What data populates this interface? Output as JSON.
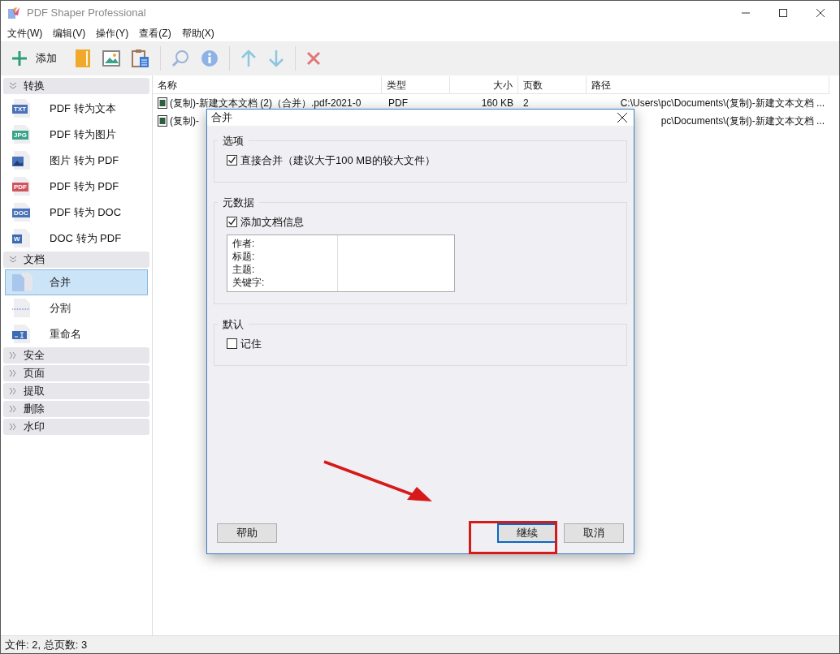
{
  "window": {
    "title": "PDF Shaper Professional"
  },
  "menu": [
    "文件(W)",
    "编辑(V)",
    "操作(Y)",
    "查看(Z)",
    "帮助(X)"
  ],
  "toolbar": [
    {
      "kind": "add",
      "label": "添加"
    },
    {
      "kind": "folder"
    },
    {
      "kind": "image"
    },
    {
      "kind": "paste"
    },
    {
      "kind": "separator"
    },
    {
      "kind": "search"
    },
    {
      "kind": "info"
    },
    {
      "kind": "separator"
    },
    {
      "kind": "up"
    },
    {
      "kind": "down"
    },
    {
      "kind": "separator"
    },
    {
      "kind": "delete"
    }
  ],
  "sidebar": {
    "groups": [
      {
        "label": "转换",
        "expanded": true,
        "items": [
          {
            "label": "PDF 转为文本",
            "kind": "badge",
            "icon_text": "TXT",
            "color": "#4a72b8",
            "selected": false
          },
          {
            "label": "PDF 转为图片",
            "kind": "badge",
            "icon_text": "JPG",
            "color": "#3aa48a",
            "selected": false
          },
          {
            "label": "图片 转为 PDF",
            "kind": "image",
            "selected": false
          },
          {
            "label": "PDF 转为 PDF",
            "kind": "badge",
            "icon_text": "PDF",
            "color": "#d0545e",
            "selected": false
          },
          {
            "label": "PDF 转为 DOC",
            "kind": "badge",
            "icon_text": "DOC",
            "color": "#4a72b8",
            "selected": false
          },
          {
            "label": "DOC 转为 PDF",
            "kind": "badge",
            "icon_text": "W",
            "color": "#3c6cb4",
            "selected": false
          }
        ]
      },
      {
        "label": "文档",
        "expanded": true,
        "items": [
          {
            "label": "合并",
            "kind": "merge",
            "selected": true
          },
          {
            "label": "分割",
            "kind": "split",
            "selected": false
          },
          {
            "label": "重命名",
            "kind": "rename",
            "selected": false
          }
        ]
      },
      {
        "label": "安全",
        "expanded": false
      },
      {
        "label": "页面",
        "expanded": false
      },
      {
        "label": "提取",
        "expanded": false
      },
      {
        "label": "删除",
        "expanded": false
      },
      {
        "label": "水印",
        "expanded": false
      }
    ]
  },
  "table": {
    "columns": [
      "名称",
      "类型",
      "大小",
      "页数",
      "路径"
    ],
    "rows": [
      {
        "name": "(复制)-新建文本文档 (2)（合并）.pdf-2021-0",
        "type": "PDF",
        "size": "160 KB",
        "pages": "2",
        "path": "C:\\Users\\pc\\Documents\\(复制)-新建文本文档 ..."
      },
      {
        "name": "(复制)-",
        "path": "pc\\Documents\\(复制)-新建文本文档 ..."
      }
    ]
  },
  "dialog": {
    "title": "合并",
    "sections": [
      {
        "title": "选项",
        "checkbox": {
          "label": "直接合并（建议大于100 MB的较大文件）",
          "checked": true
        }
      },
      {
        "title": "元数据",
        "checkbox": {
          "label": "添加文档信息",
          "checked": true
        },
        "fields": [
          "作者:",
          "标题:",
          "主题:",
          "关键字:"
        ]
      },
      {
        "title": "默认",
        "checkbox": {
          "label": "记住",
          "checked": false
        }
      }
    ],
    "buttons": [
      {
        "label": "帮助",
        "kind": "help"
      },
      {
        "label": "继续",
        "kind": "default"
      },
      {
        "label": "取消",
        "kind": "normal"
      }
    ]
  },
  "status_bar": "文件: 2, 总页数: 3"
}
